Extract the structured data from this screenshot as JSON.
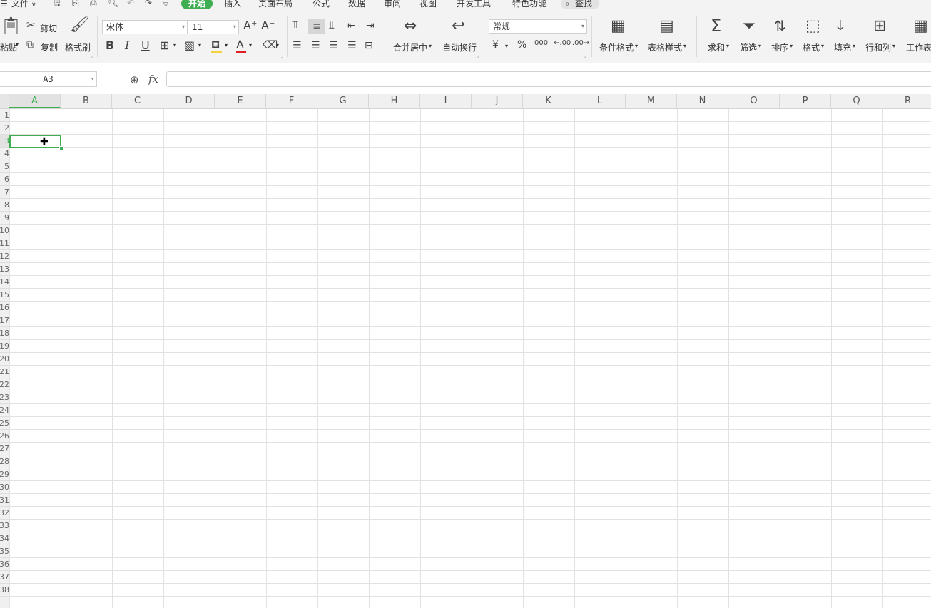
{
  "menubar": {
    "menu_label": "文件",
    "tabs": [
      "开始",
      "插入",
      "页面布局",
      "公式",
      "数据",
      "审阅",
      "视图",
      "开发工具",
      "特色功能"
    ],
    "active_tab": "开始",
    "search_label": "查找"
  },
  "ribbon": {
    "clipboard": {
      "paste": "粘贴",
      "cut": "剪切",
      "copy": "复制",
      "format_painter": "格式刷"
    },
    "font": {
      "name": "宋体",
      "size": "11"
    },
    "alignment": {
      "merge_center": "合并居中",
      "wrap_text": "自动换行"
    },
    "number": {
      "format": "常规",
      "currency": "¥",
      "percent": "%",
      "thousands": "000",
      "inc_decimal": ".00",
      "dec_decimal": ".00"
    },
    "styles": {
      "conditional_format": "条件格式",
      "table_style": "表格样式"
    },
    "editing": {
      "sum": "求和",
      "filter": "筛选",
      "sort": "排序",
      "format": "格式",
      "fill": "填充",
      "rows_cols": "行和列",
      "worksheet": "工作表"
    }
  },
  "formula_bar": {
    "cell_ref": "A3",
    "fx": "fx",
    "content": ""
  },
  "sheet": {
    "columns": [
      "A",
      "B",
      "C",
      "D",
      "E",
      "F",
      "G",
      "H",
      "I",
      "J",
      "K",
      "L",
      "M",
      "N",
      "O",
      "P",
      "Q",
      "R"
    ],
    "active_column": "A",
    "rows": [
      "1",
      "2",
      "3",
      "4",
      "5",
      "6",
      "7",
      "8",
      "9",
      "10",
      "11",
      "12",
      "13",
      "14",
      "15",
      "16",
      "17",
      "18",
      "19",
      "20",
      "21",
      "22",
      "23",
      "24",
      "25",
      "26",
      "27",
      "28",
      "29",
      "30",
      "31",
      "32",
      "33",
      "34",
      "35",
      "36",
      "37",
      "38"
    ],
    "active_row": "3"
  },
  "colors": {
    "accent": "#3fae52",
    "ribbon_bg": "#f3f3f3",
    "grid_line": "#e2e2e2"
  }
}
